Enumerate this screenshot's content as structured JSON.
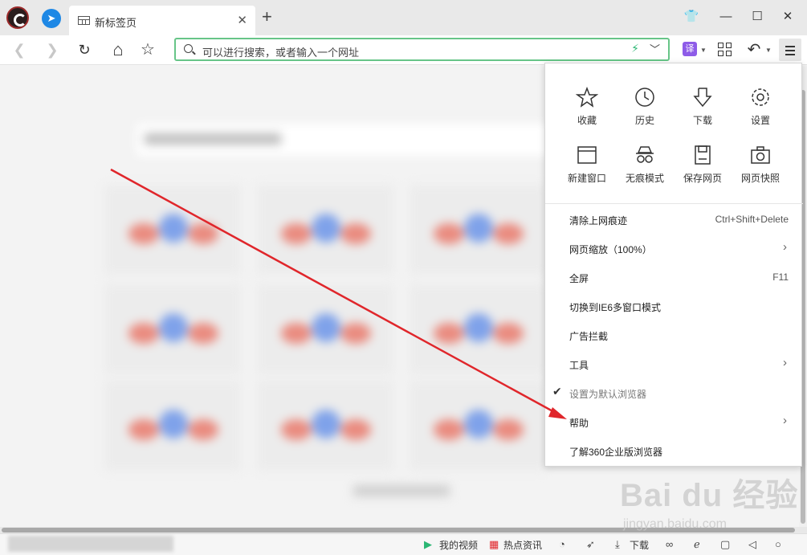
{
  "tab": {
    "title": "新标签页",
    "close": "✕"
  },
  "newtab_symbol": "+",
  "window": {
    "skin": "👕",
    "minimize": "—",
    "maximize": "☐",
    "close": "✕"
  },
  "toolbar": {
    "back": "❮",
    "forward": "❯",
    "reload": "↻",
    "home": "⌂",
    "favorite": "☆",
    "translate": "译",
    "undo": "↶"
  },
  "address": {
    "placeholder": "可以进行搜索，或者输入一个网址"
  },
  "menu": {
    "quick": [
      {
        "icon": "star-icon",
        "label": "收藏"
      },
      {
        "icon": "history-icon",
        "label": "历史"
      },
      {
        "icon": "download-icon",
        "label": "下载"
      },
      {
        "icon": "settings-icon",
        "label": "设置"
      },
      {
        "icon": "new-window-icon",
        "label": "新建窗口"
      },
      {
        "icon": "incognito-icon",
        "label": "无痕模式"
      },
      {
        "icon": "save-page-icon",
        "label": "保存网页"
      },
      {
        "icon": "camera-icon",
        "label": "网页快照"
      }
    ],
    "items": [
      {
        "label": "清除上网痕迹",
        "shortcut": "Ctrl+Shift+Delete"
      },
      {
        "label": "网页缩放（100%）",
        "arrow": "›"
      },
      {
        "label": "全屏",
        "shortcut": "F11"
      },
      {
        "label": "切换到IE6多窗口模式"
      },
      {
        "label": "广告拦截"
      },
      {
        "label": "工具",
        "arrow": "›"
      },
      {
        "label": "设置为默认浏览器",
        "check": "✔"
      },
      {
        "label": "帮助",
        "arrow": "›"
      },
      {
        "label": "了解360企业版浏览器"
      }
    ]
  },
  "statusbar": {
    "video": "我的视频",
    "news": "热点资讯",
    "download": "下载"
  },
  "watermark": {
    "text": "Bai du 经验",
    "url": "jingyan.baidu.com"
  },
  "colors": {
    "address_border": "#67c588",
    "arrow": "#e0262b",
    "translate_bg": "#8e5ce8"
  }
}
